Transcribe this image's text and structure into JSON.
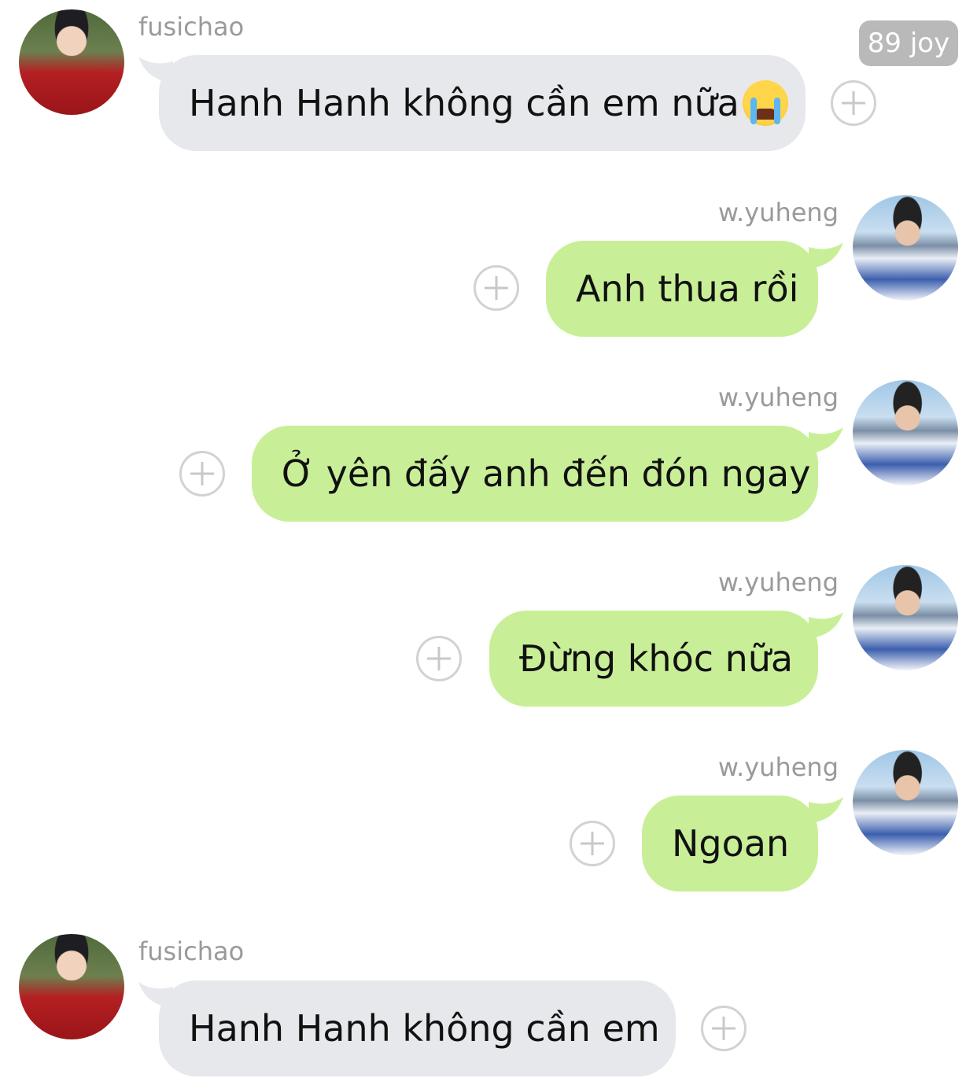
{
  "badge": "89 joy",
  "messages": [
    {
      "sender": "fusichao",
      "text": "Hanh Hanh không cần em nữa",
      "emoji": "loudly-crying-face"
    },
    {
      "sender": "w.yuheng",
      "text": "Anh thua rồi"
    },
    {
      "sender": "w.yuheng",
      "text": "Ở yên đấy anh đến đón ngay"
    },
    {
      "sender": "w.yuheng",
      "text": "Đừng khóc nữa"
    },
    {
      "sender": "w.yuheng",
      "text": "Ngoan"
    },
    {
      "sender": "fusichao",
      "text": "Hanh Hanh không cần em"
    }
  ],
  "colors": {
    "incoming_bubble": "#e6e8eb",
    "outgoing_bubble": "#c8ef97",
    "name_text": "#9a9a9a",
    "badge_bg": "#b9b9b9"
  }
}
